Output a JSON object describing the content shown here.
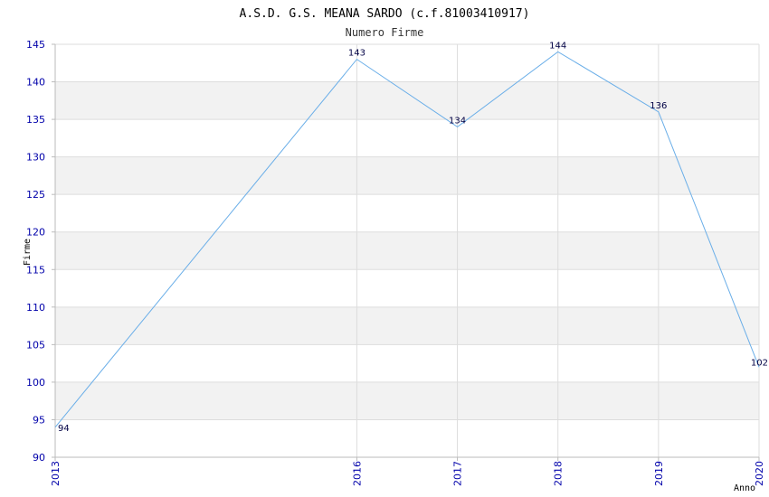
{
  "colors": {
    "line": "#6aaee8",
    "band": "#f2f2f2",
    "grid": "#dddddd",
    "tick_text": "#0000aa"
  },
  "chart_data": {
    "type": "line",
    "title": "A.S.D. G.S. MEANA SARDO (c.f.81003410917)",
    "subtitle": "Numero Firme",
    "xlabel": "Anno",
    "ylabel": "Firme",
    "x": [
      "2013",
      "2016",
      "2017",
      "2018",
      "2019",
      "2020"
    ],
    "series": [
      {
        "values": [
          94,
          143,
          134,
          144,
          136,
          102
        ]
      }
    ],
    "ylim": [
      90,
      145
    ],
    "yticks": [
      90,
      95,
      100,
      105,
      110,
      115,
      120,
      125,
      130,
      135,
      140,
      145
    ],
    "grid": true,
    "point_labels": true
  }
}
